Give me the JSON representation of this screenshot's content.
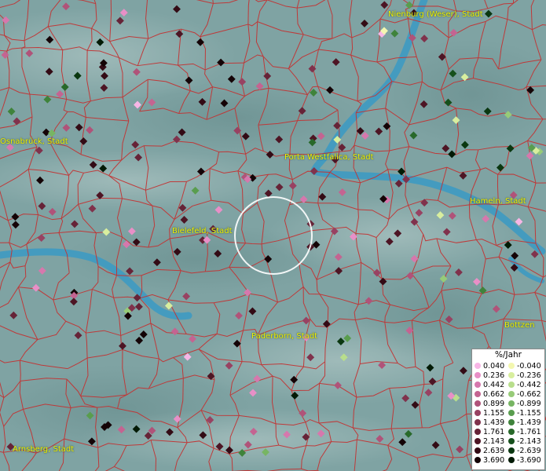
{
  "map": {
    "cities": [
      {
        "name": "Nienburg (Weser), Stadt"
      },
      {
        "name": "Osnabrück, Stadt"
      },
      {
        "name": "Porta Westfalica, Stadt"
      },
      {
        "name": "Hameln, Stadt"
      },
      {
        "name": "Bielefeld, Stadt"
      },
      {
        "name": "Paderborn, Stadt"
      },
      {
        "name": "Bottzen"
      },
      {
        "name": "Arnsberg, Stadt"
      }
    ],
    "colors": {
      "background": "#7fa3a3",
      "river": "#3a9ac4",
      "borders": "#c23434",
      "city_label": "#f2f200"
    }
  },
  "legend": {
    "title": "%/Jahr",
    "positive": [
      {
        "value": "0.040",
        "color": "#f7b6e6"
      },
      {
        "value": "0.236",
        "color": "#e88fc7"
      },
      {
        "value": "0.442",
        "color": "#d678ad"
      },
      {
        "value": "0.662",
        "color": "#c46491"
      },
      {
        "value": "0.899",
        "color": "#b05379"
      },
      {
        "value": "1.155",
        "color": "#984262"
      },
      {
        "value": "1.439",
        "color": "#80324c"
      },
      {
        "value": "1.761",
        "color": "#662337"
      },
      {
        "value": "2.143",
        "color": "#4d1524"
      },
      {
        "value": "2.639",
        "color": "#330b15"
      },
      {
        "value": "3.690",
        "color": "#140306"
      }
    ],
    "negative": [
      {
        "value": "-0.040",
        "color": "#f3f7b0"
      },
      {
        "value": "-0.236",
        "color": "#d8ee9e"
      },
      {
        "value": "-0.442",
        "color": "#b8de8c"
      },
      {
        "value": "-0.662",
        "color": "#97cb78"
      },
      {
        "value": "-0.899",
        "color": "#77b563"
      },
      {
        "value": "-1.155",
        "color": "#599d4e"
      },
      {
        "value": "-1.439",
        "color": "#3f833b"
      },
      {
        "value": "-1.761",
        "color": "#28692a"
      },
      {
        "value": "-2.143",
        "color": "#16501c"
      },
      {
        "value": "-2.639",
        "color": "#0a3710"
      },
      {
        "value": "-3.690",
        "color": "#021a05"
      }
    ]
  }
}
